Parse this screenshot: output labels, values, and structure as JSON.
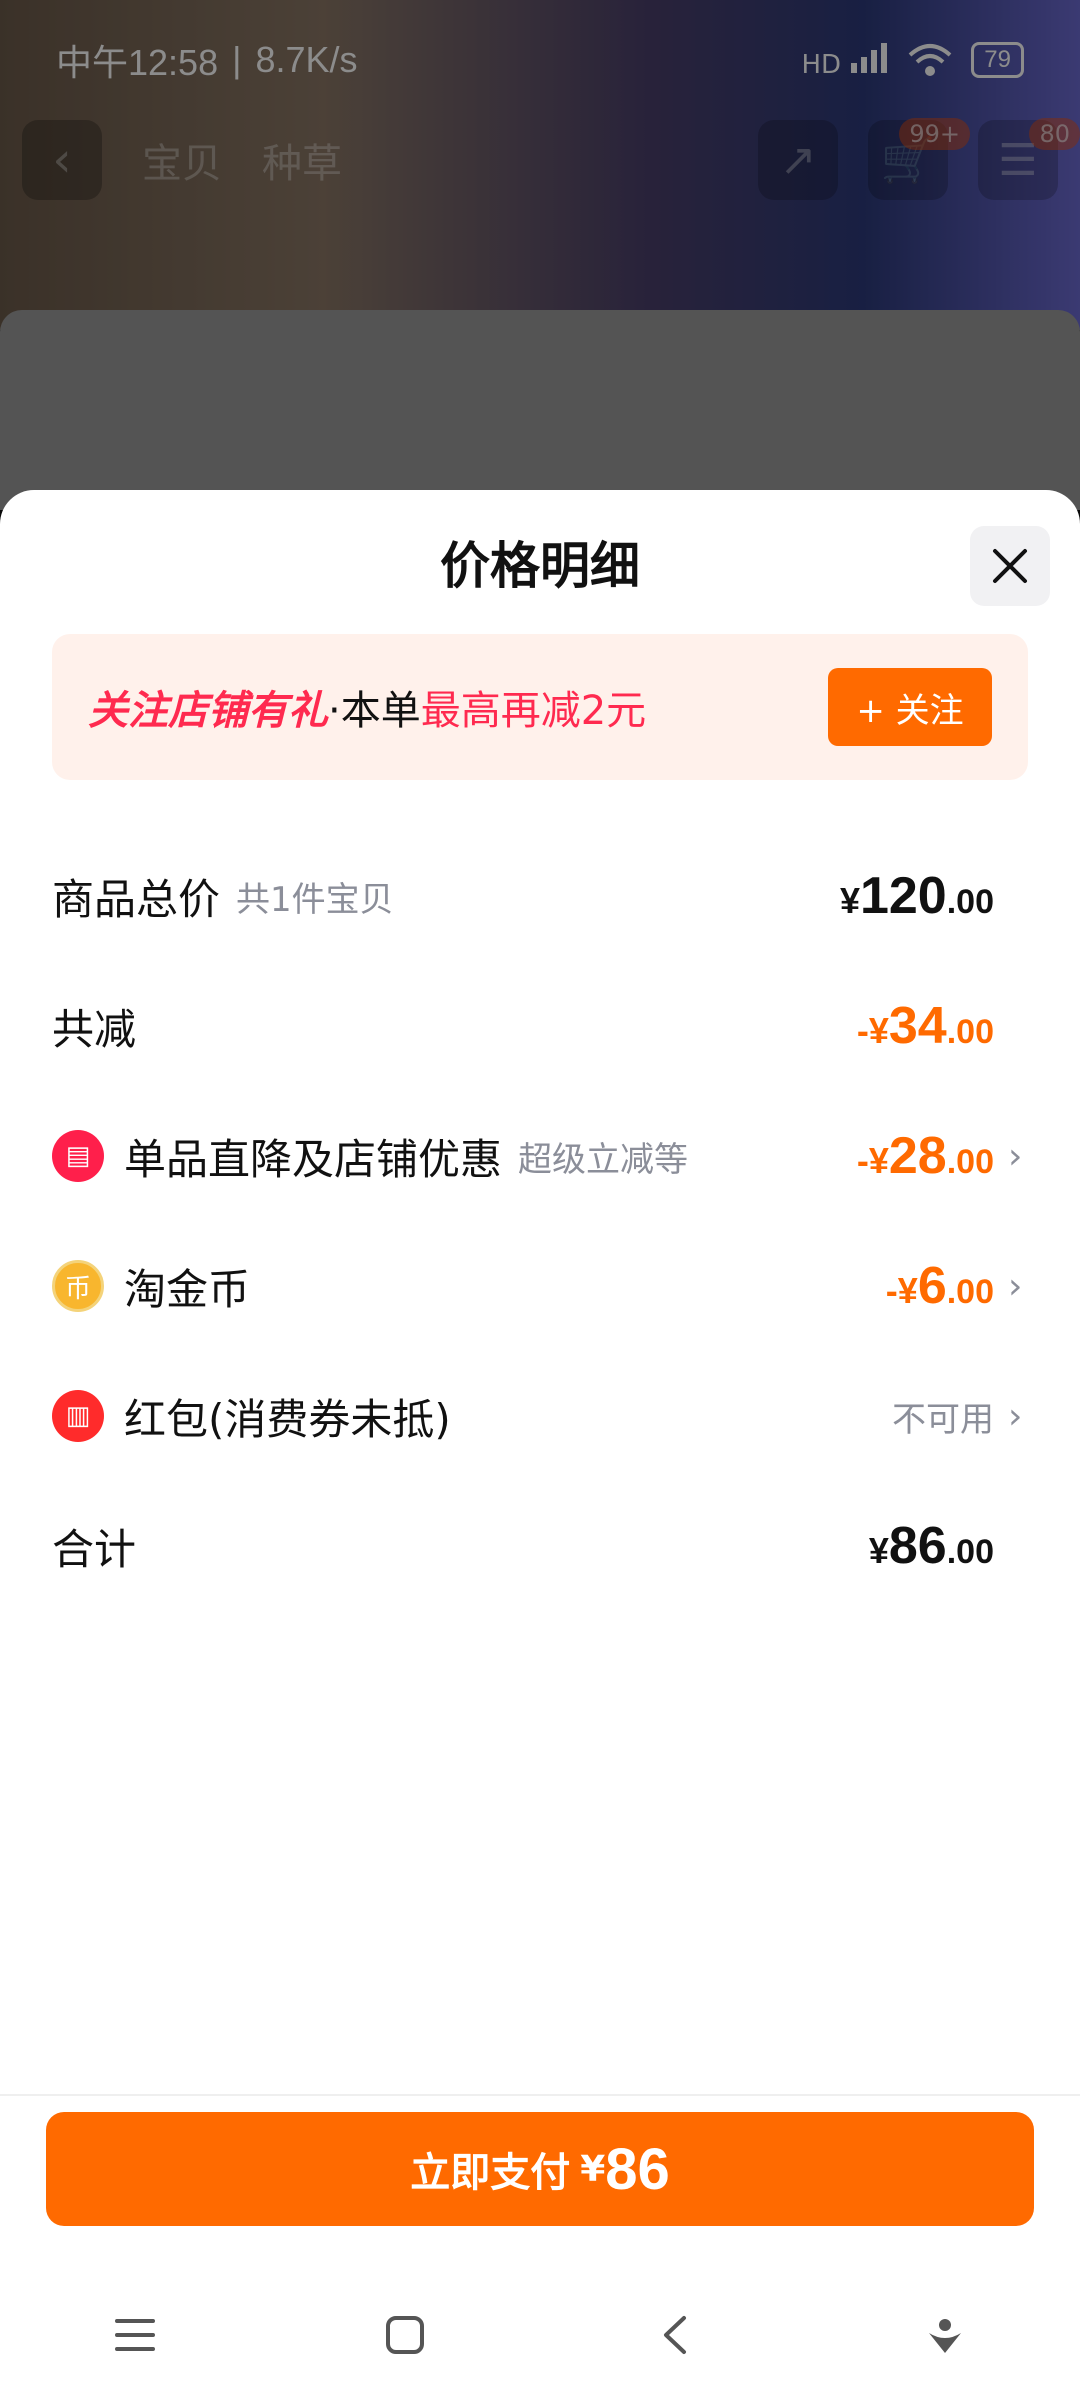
{
  "status_bar": {
    "time": "中午12:58",
    "speed": "8.7K/s",
    "network": "HD",
    "battery": "79"
  },
  "header": {
    "tabs": [
      "宝贝",
      "种草"
    ],
    "cart_badge": "99+",
    "msg_badge": "80"
  },
  "sheet": {
    "title": "价格明细",
    "promo": {
      "highlight": "关注店铺有礼",
      "mid": "·本单",
      "offer": "最高再减2元",
      "button": "+ 关注"
    },
    "rows": {
      "total": {
        "label": "商品总价",
        "sub": "共1件宝贝",
        "cur": "¥",
        "int": "120",
        "dec": ".00"
      },
      "discount": {
        "label": "共减",
        "cur": "-¥",
        "int": "34",
        "dec": ".00"
      },
      "store_discount": {
        "label": "单品直降及店铺优惠",
        "sub": "超级立减等",
        "cur": "-¥",
        "int": "28",
        "dec": ".00"
      },
      "coins": {
        "label": "淘金币",
        "cur": "-¥",
        "int": "6",
        "dec": ".00"
      },
      "red_packet": {
        "label": "红包(消费券未抵)",
        "status": "不可用"
      },
      "sum": {
        "label": "合计",
        "cur": "¥",
        "int": "86",
        "dec": ".00"
      }
    },
    "pay": {
      "label": "立即支付",
      "cur": "¥",
      "value": "86"
    }
  },
  "colors": {
    "accent": "#ff6a00",
    "promo_red": "#ff2a4f",
    "promo_bg": "#fff1eb"
  },
  "icons": [
    "back-icon",
    "share-icon",
    "cart-icon",
    "close-icon",
    "store-icon",
    "coin-icon",
    "red-packet-icon",
    "chevron-right-icon",
    "menu-icon",
    "home-icon",
    "back-nav-icon",
    "assistant-icon"
  ]
}
